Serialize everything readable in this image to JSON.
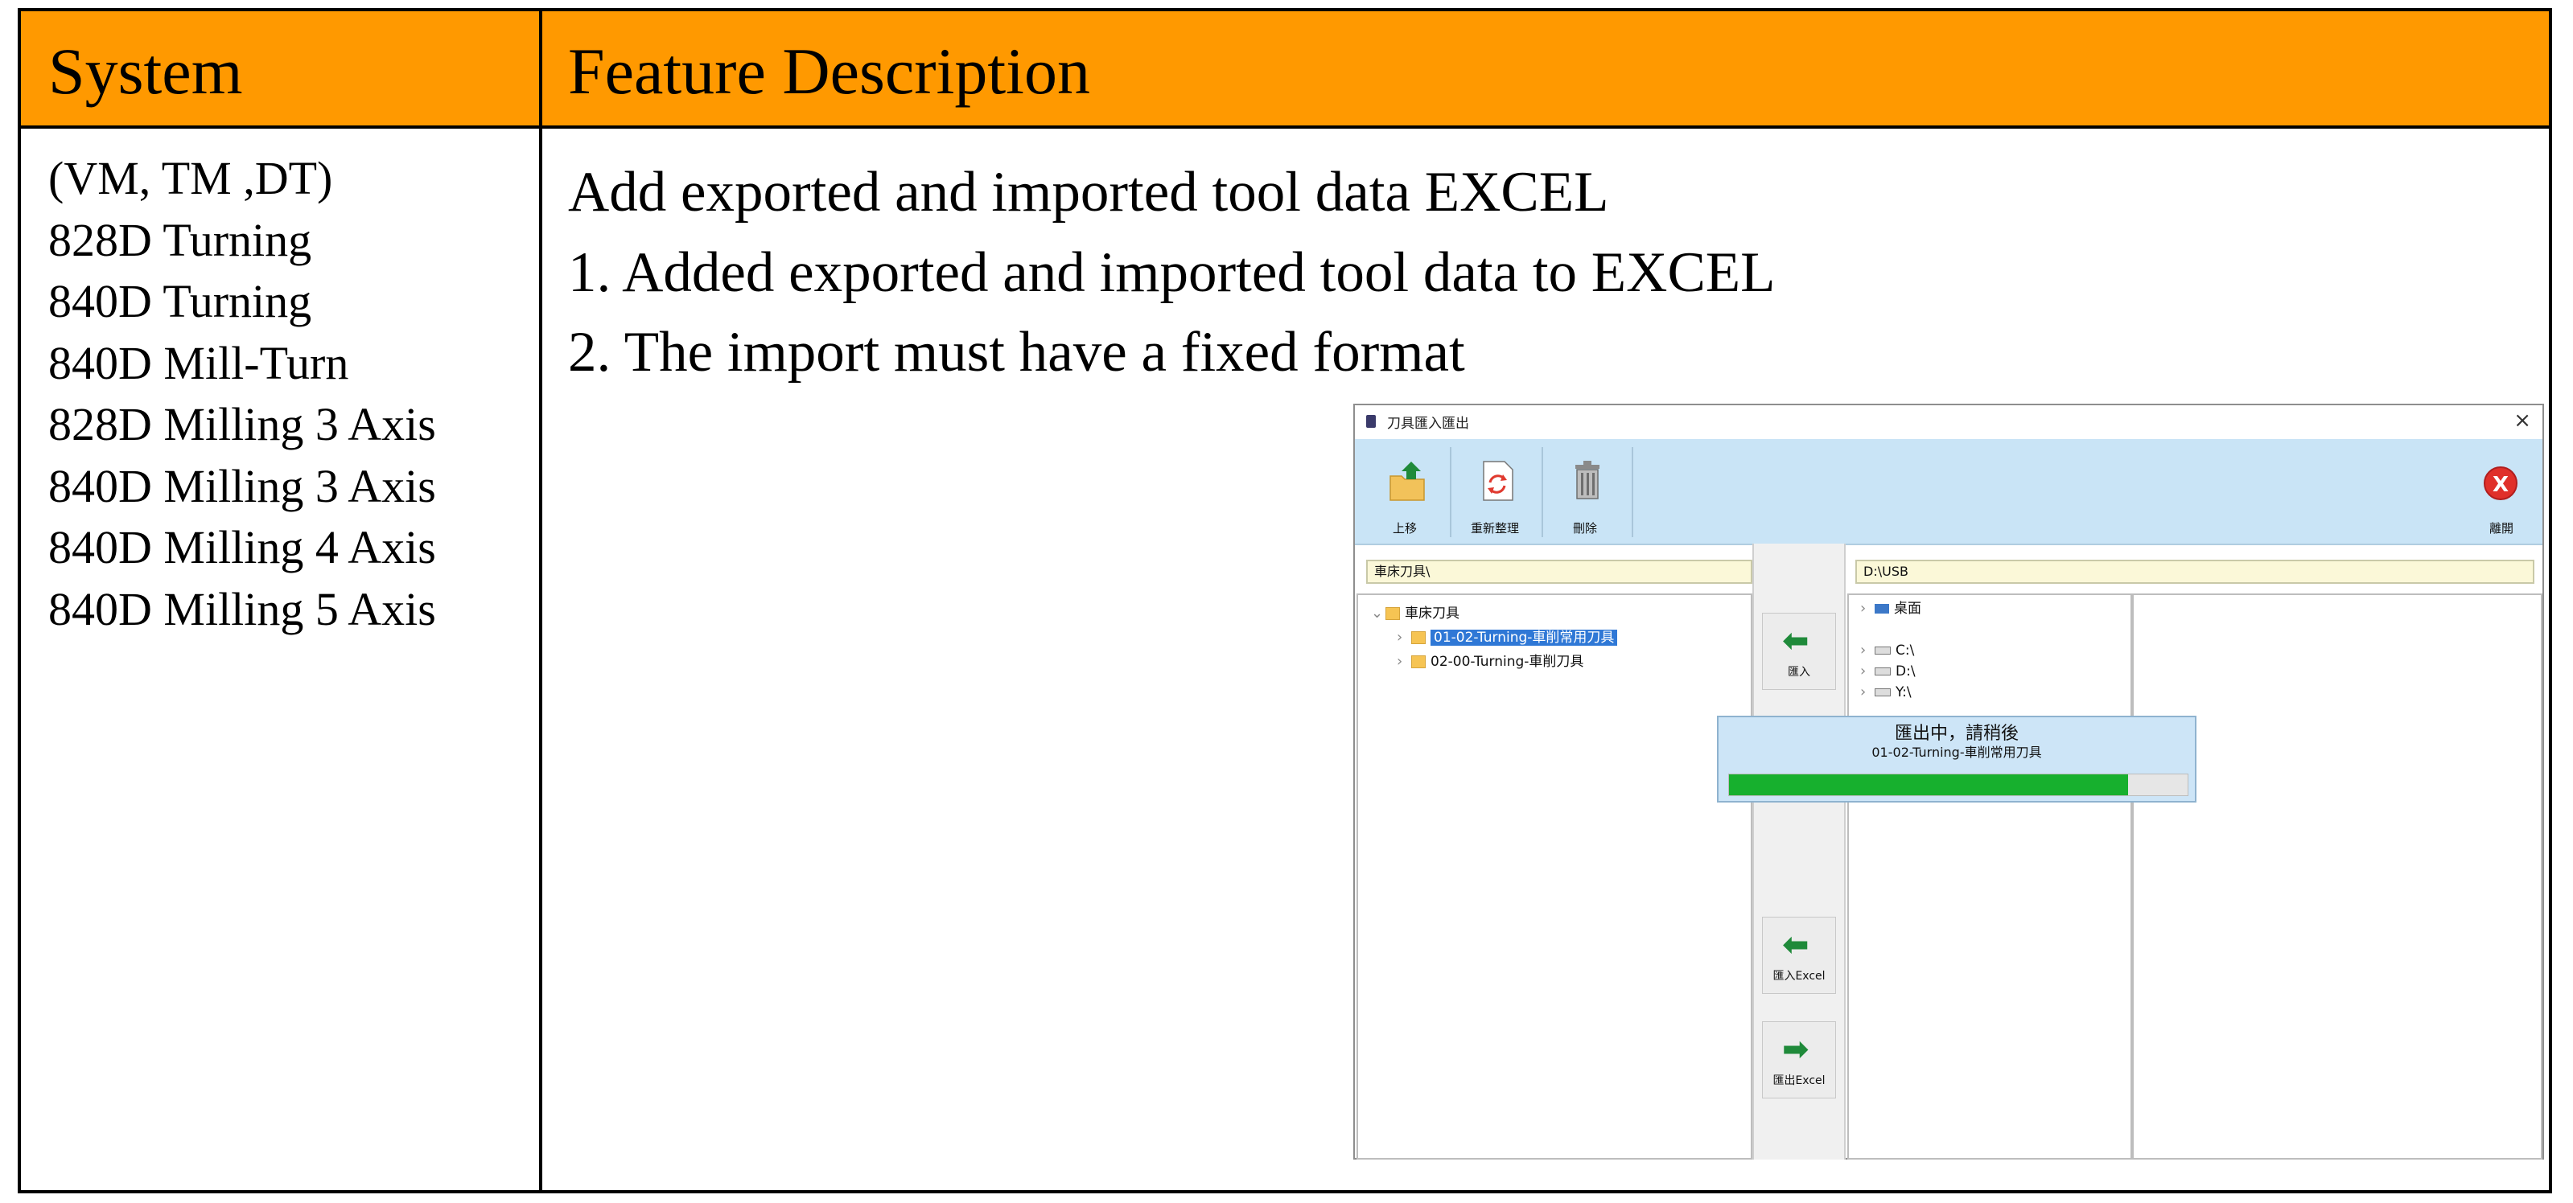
{
  "table": {
    "header": {
      "system": "System",
      "feature": "Feature Description"
    },
    "systems": [
      "(VM, TM ,DT)",
      "828D Turning",
      "840D Turning",
      "840D Mill-Turn",
      "828D Milling 3 Axis",
      "840D Milling 3 Axis",
      "840D Milling 4 Axis",
      "840D Milling 5 Axis"
    ],
    "feature_lines": [
      "Add exported and imported tool data EXCEL",
      "1. Added exported and imported tool data to EXCEL",
      "2. The import must have a fixed format"
    ]
  },
  "app": {
    "title": "刀具匯入匯出",
    "close_glyph": "×",
    "toolbar": {
      "up_label": "上移",
      "refresh_label": "重新整理",
      "delete_label": "刪除",
      "exit_label": "離開",
      "exit_glyph": "X"
    },
    "left_path": "車床刀具\\",
    "right_path": "D:\\USB",
    "left_tree": {
      "root": "車床刀具",
      "children": [
        "01-02-Turning-車削常用刀具",
        "02-00-Turning-車削刀具"
      ]
    },
    "right_tree": {
      "desktop": "桌面",
      "drives": [
        "C:\\",
        "D:\\",
        "Y:\\"
      ]
    },
    "buttons": {
      "import_label": "匯入",
      "import_excel_label": "匯入Excel",
      "export_excel_label": "匯出Excel"
    },
    "progress": {
      "line1": "匯出中，請稍後",
      "line2": "01-02-Turning-車削常用刀具",
      "fraction": 0.87
    },
    "colors": {
      "header_orange": "#ff9900",
      "toolbar_blue": "#c9e4f6",
      "progress_green": "#17b02e",
      "selection_blue": "#2f78d6"
    },
    "icons": [
      "folder-up-icon",
      "refresh-icon",
      "trash-icon",
      "exit-icon",
      "arrow-left-icon",
      "arrow-right-icon",
      "folder-icon",
      "desktop-icon",
      "drive-icon",
      "chevron-right-icon",
      "chevron-down-icon"
    ]
  }
}
